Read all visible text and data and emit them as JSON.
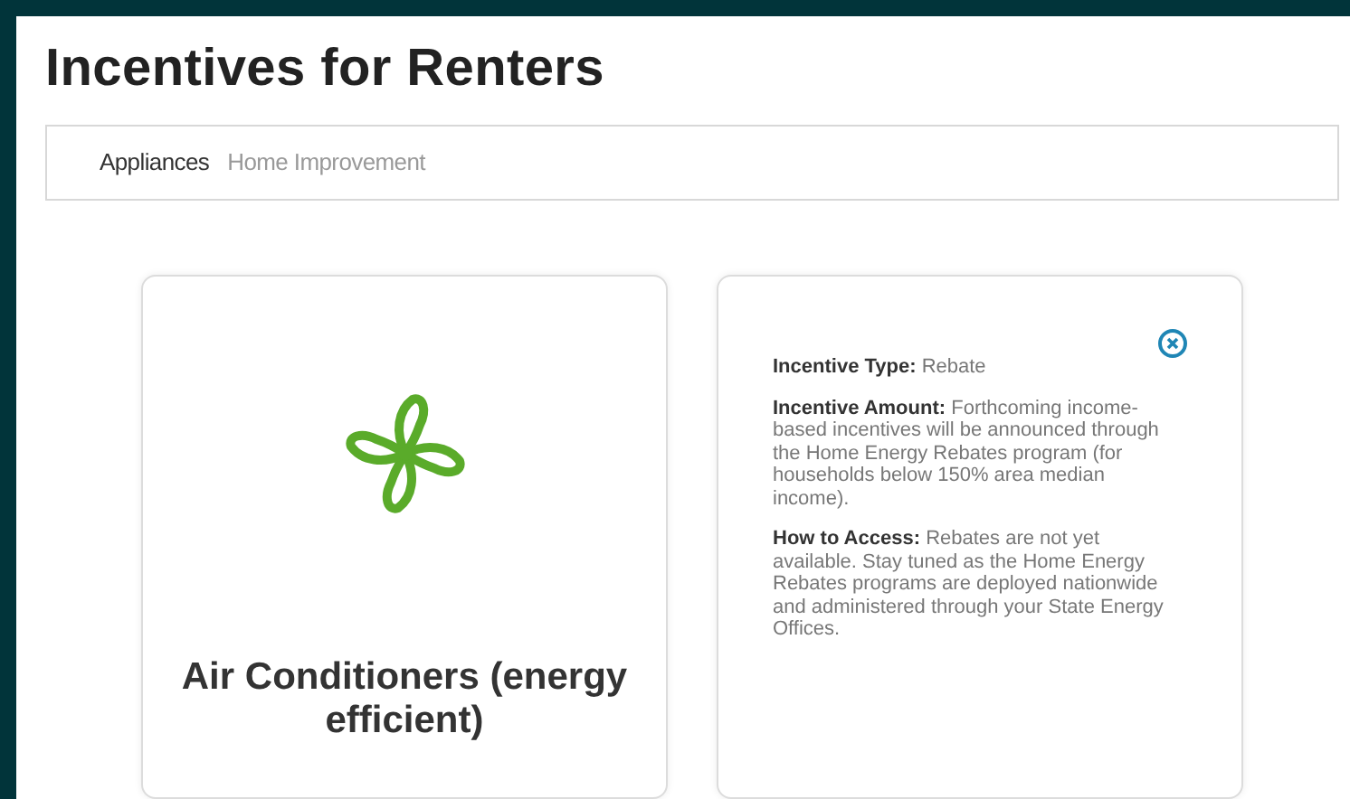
{
  "title": "Incentives for Renters",
  "tabs": [
    {
      "label": "Appliances",
      "selected": true
    },
    {
      "label": "Home Improvement",
      "selected": false
    }
  ],
  "cards": [
    {
      "kind": "front",
      "title": "Air Conditioners (energy efficient)"
    },
    {
      "kind": "back",
      "paragraphs": [
        "**Incentive Type:** Rebate",
        "**Incentive Amount:** Forthcoming income-based incentives will be announced through the Home Energy Rebates program (for households below 150% area median income).",
        "**How to Access:** Rebates are not yet available. Stay tuned as the Home Energy Rebates programs are deployed nationwide and administered through your State Energy Offices."
      ]
    }
  ]
}
